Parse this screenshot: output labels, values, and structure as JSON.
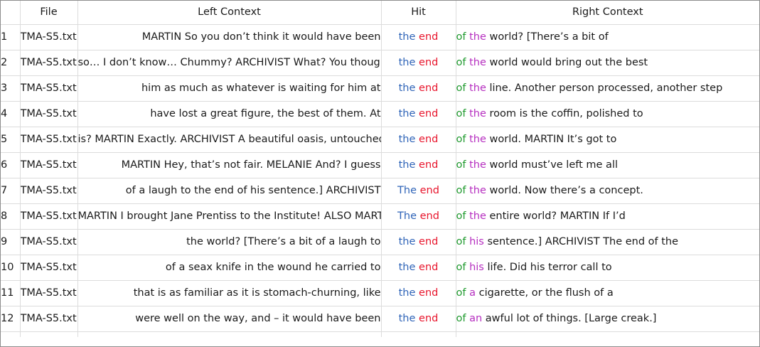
{
  "columns": {
    "index": "",
    "file": "File",
    "left": "Left Context",
    "hit": "Hit",
    "right": "Right Context"
  },
  "colors": {
    "hit_first": "#2f64b8",
    "hit_second": "#e8162d",
    "right_first": "#1f9a2e",
    "right_second": "#b62fc0"
  },
  "rows": [
    {
      "n": "1",
      "file": "TMA-S5.txt",
      "left": "MARTIN So you don’t think it would have been",
      "hit1": "the",
      "hit2": "end",
      "r1": "of",
      "r2": "the",
      "rest": "world? [There’s a bit of"
    },
    {
      "n": "2",
      "file": "TMA-S5.txt",
      "left": "so… I don’t know… Chummy? ARCHIVIST What? You thought",
      "hit1": "the",
      "hit2": "end",
      "r1": "of",
      "r2": "the",
      "rest": "world would bring out the best"
    },
    {
      "n": "3",
      "file": "TMA-S5.txt",
      "left": "him as much as whatever is waiting for him at",
      "hit1": "the",
      "hit2": "end",
      "r1": "of",
      "r2": "the",
      "rest": "line. Another person processed, another step"
    },
    {
      "n": "4",
      "file": "TMA-S5.txt",
      "left": "have lost a great figure, the best of them. At",
      "hit1": "the",
      "hit2": "end",
      "r1": "of",
      "r2": "the",
      "rest": "room is the coffin, polished to"
    },
    {
      "n": "5",
      "file": "TMA-S5.txt",
      "left": "is? MARTIN Exactly. ARCHIVIST A beautiful oasis, untouched by",
      "hit1": "the",
      "hit2": "end",
      "r1": "of",
      "r2": "the",
      "rest": "world. MARTIN It’s got to"
    },
    {
      "n": "6",
      "file": "TMA-S5.txt",
      "left": "MARTIN Hey, that’s not fair. MELANIE And? I guess",
      "hit1": "the",
      "hit2": "end",
      "r1": "of",
      "r2": "the",
      "rest": "world must’ve left me all"
    },
    {
      "n": "7",
      "file": "TMA-S5.txt",
      "left": "of a laugh to the end of his sentence.] ARCHIVIST",
      "hit1": "The",
      "hit2": "end",
      "r1": "of",
      "r2": "the",
      "rest": "world. Now there’s a concept."
    },
    {
      "n": "8",
      "file": "TMA-S5.txt",
      "left": "MARTIN I brought Jane Prentiss to the Institute! ALSO MARTIN",
      "hit1": "The",
      "hit2": "end",
      "r1": "of",
      "r2": "the",
      "rest": "entire world? MARTIN If I’d"
    },
    {
      "n": "9",
      "file": "TMA-S5.txt",
      "left": "the world? [There’s a bit of a laugh to",
      "hit1": "the",
      "hit2": "end",
      "r1": "of",
      "r2": "his",
      "rest": "sentence.] ARCHIVIST The end of the"
    },
    {
      "n": "10",
      "file": "TMA-S5.txt",
      "left": "of a seax knife in the wound he carried to",
      "hit1": "the",
      "hit2": "end",
      "r1": "of",
      "r2": "his",
      "rest": "life. Did his terror call to"
    },
    {
      "n": "11",
      "file": "TMA-S5.txt",
      "left": "that is as familiar as it is stomach-churning, like",
      "hit1": "the",
      "hit2": "end",
      "r1": "of",
      "r2": "a",
      "rest": "cigarette, or the flush of a"
    },
    {
      "n": "12",
      "file": "TMA-S5.txt",
      "left": "were well on the way, and – it would have been",
      "hit1": "the",
      "hit2": "end",
      "r1": "of",
      "r2": "an",
      "rest": "awful lot of things. [Large creak.]"
    }
  ]
}
